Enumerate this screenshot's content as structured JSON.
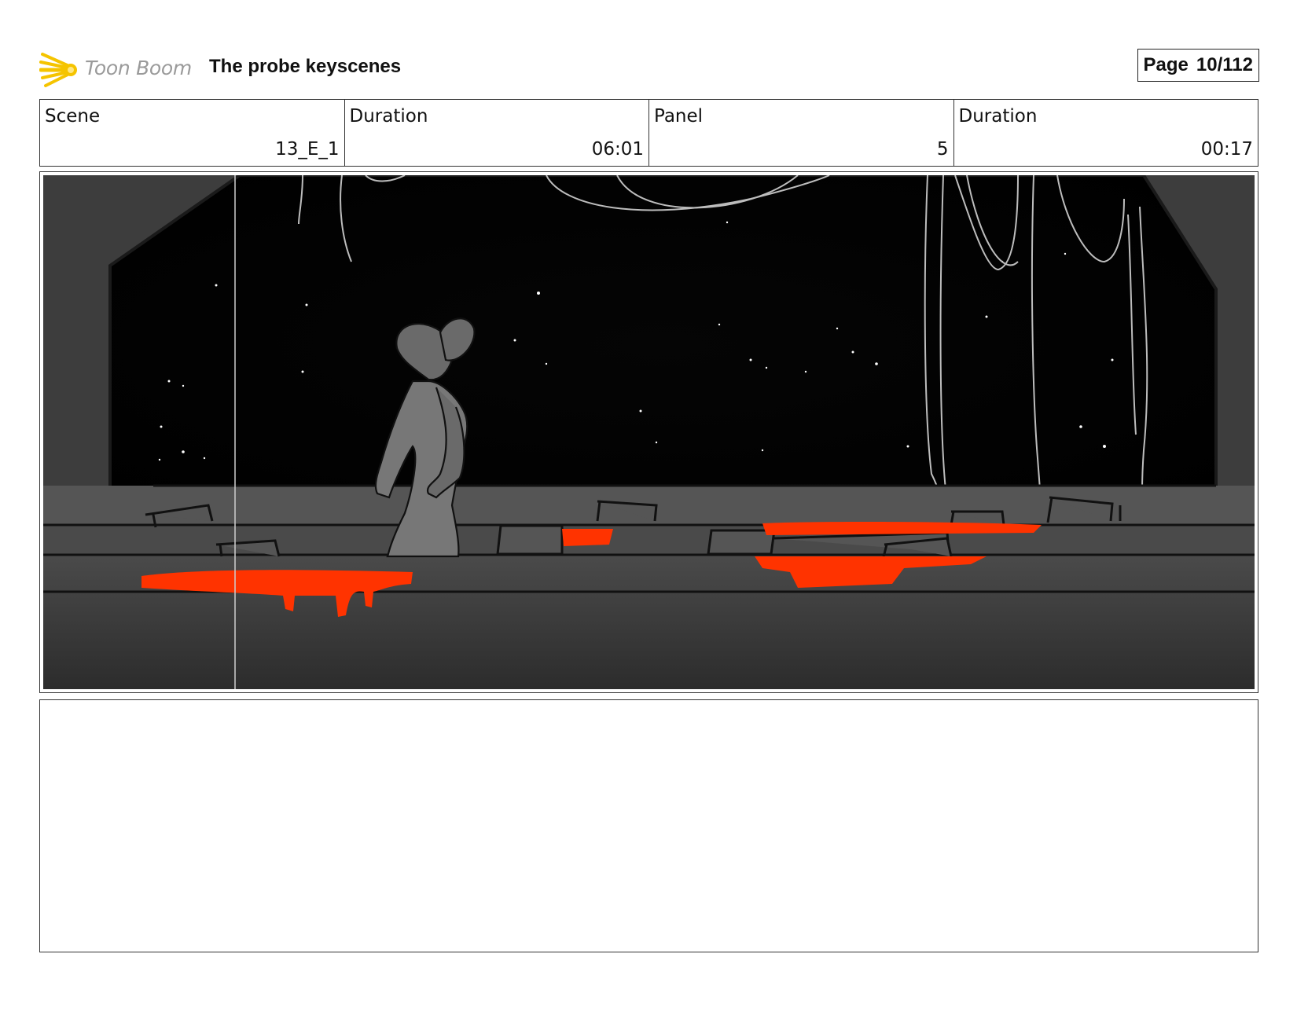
{
  "header": {
    "logo_text": "Toon Boom",
    "title": "The probe keyscenes",
    "page_label": "Page",
    "page_number": "10/112"
  },
  "info": {
    "scene_label": "Scene",
    "scene_value": "13_E_1",
    "scene_duration_label": "Duration",
    "scene_duration_value": "06:01",
    "panel_label": "Panel",
    "panel_value": "5",
    "panel_duration_label": "Duration",
    "panel_duration_value": "00:17"
  },
  "colors": {
    "accent_red": "#ff3300",
    "logo_yellow": "#f5c400",
    "space": "#000000",
    "wall": "#3a3a3a"
  },
  "icons": {
    "logo": "toon-boom-star-icon"
  },
  "notes": {
    "text": ""
  }
}
